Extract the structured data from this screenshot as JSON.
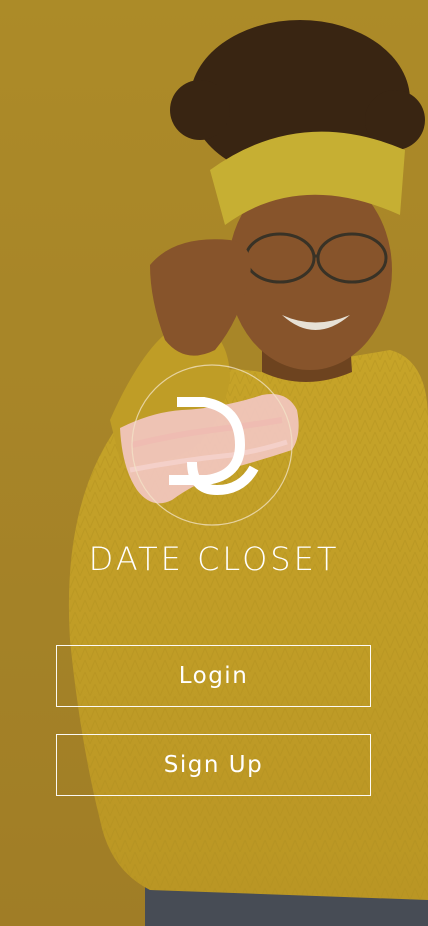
{
  "brand": {
    "name": "DATE CLOSET",
    "logo_icon": "dc-monogram-logo"
  },
  "actions": {
    "login_label": "Login",
    "signup_label": "Sign Up"
  },
  "colors": {
    "background": "#b8952f",
    "sweater": "#d7b42a",
    "logo_brush": "#f2c7c0",
    "text": "#ffffff"
  }
}
